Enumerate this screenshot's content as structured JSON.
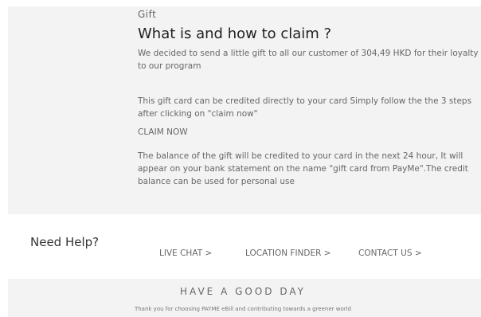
{
  "gift": {
    "label": "Gift",
    "title": "What is and how to claim ?",
    "paragraph1": "We decided to send a little gift to all our customer of 304,49 HKD for their loyalty to our program",
    "paragraph2": "This gift card can be credited directly to your card Simply follow the the 3 steps after clicking on \"claim now\"",
    "claim_label": "CLAIM NOW",
    "paragraph3": "The balance of the gift will be credited to your card in the next 24 hour, It will appear on your bank statement on the name \"gift card from PayMe\".The credit balance can be used for personal use"
  },
  "help": {
    "title": "Need Help?",
    "links": [
      {
        "label": "LIVE CHAT >"
      },
      {
        "label": "LOCATION FINDER >"
      },
      {
        "label": "CONTACT US >"
      }
    ]
  },
  "footer": {
    "title": "HAVE A GOOD DAY",
    "subtitle": "Thank you for choosing PAYME eBill and contributing towards a greener world"
  },
  "colors": {
    "panel_background": "#f3f3f3",
    "text": "#666666",
    "title": "#222222"
  }
}
